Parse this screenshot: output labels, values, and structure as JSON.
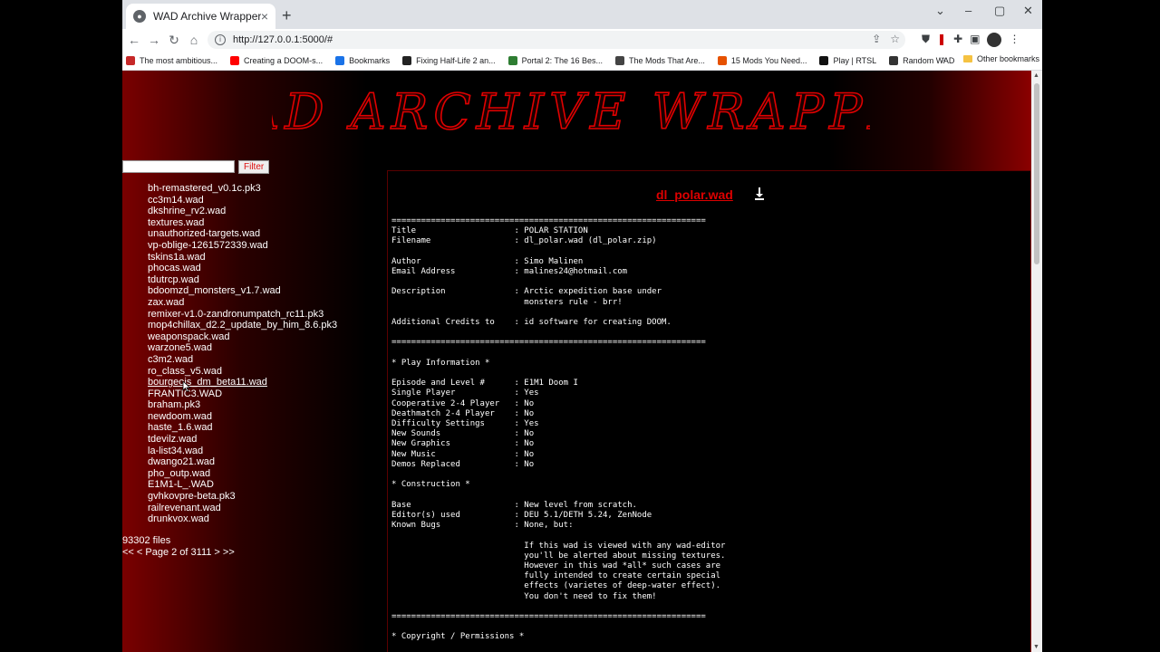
{
  "browser": {
    "tab_title": "WAD Archive Wrapper",
    "url": "http://127.0.0.1:5000/#",
    "bookmarks": [
      {
        "label": "The most ambitious...",
        "color": "#c62828"
      },
      {
        "label": "Creating a DOOM-s...",
        "color": "#ff0000"
      },
      {
        "label": "Bookmarks",
        "color": "#1a73e8"
      },
      {
        "label": "Fixing Half-Life 2 an...",
        "color": "#222222"
      },
      {
        "label": "Portal 2: The 16 Bes...",
        "color": "#2e7d32"
      },
      {
        "label": "The Mods That Are...",
        "color": "#444444"
      },
      {
        "label": "15 Mods You Need...",
        "color": "#e65100"
      },
      {
        "label": "Play | RTSL",
        "color": "#111111"
      },
      {
        "label": "Random WAD",
        "color": "#333333"
      }
    ],
    "other_bookmarks": "Other bookmarks"
  },
  "page": {
    "logo_text": "WAD ARCHIVE WRAPPER",
    "filter_button": "Filter",
    "filter_value": "",
    "files": [
      "bh-remastered_v0.1c.pk3",
      "cc3m14.wad",
      "dkshrine_rv2.wad",
      "textures.wad",
      "unauthorized-targets.wad",
      "vp-oblige-1261572339.wad",
      "tskins1a.wad",
      "phocas.wad",
      "tdutrcp.wad",
      "bdoomzd_monsters_v1.7.wad",
      "zax.wad",
      "remixer-v1.0-zandronumpatch_rc11.pk3",
      "mop4chillax_d2.2_update_by_him_8.6.pk3",
      "weaponspack.wad",
      "warzone5.wad",
      "c3m2.wad",
      "ro_class_v5.wad",
      "bourgeois_dm_beta11.wad",
      "FRANTIC3.WAD",
      "braham.pk3",
      "newdoom.wad",
      "haste_1.6.wad",
      "tdevilz.wad",
      "la-list34.wad",
      "dwango21.wad",
      "pho_outp.wad",
      "E1M1-L_.WAD",
      "gvhkovpre-beta.pk3",
      "railrevenant.wad",
      "drunkvox.wad"
    ],
    "file_count": "93302 files",
    "pager": "<< < Page 2 of 3111 > >>",
    "doc_title": "dl_polar.wad",
    "doc_text": "================================================================\nTitle                    : POLAR STATION\nFilename                 : dl_polar.wad (dl_polar.zip)\n\nAuthor                   : Simo Malinen\nEmail Address            : malines24@hotmail.com\n\nDescription              : Arctic expedition base under\n                           monsters rule - brr!\n\nAdditional Credits to    : id software for creating DOOM.\n\n================================================================\n\n* Play Information *\n\nEpisode and Level #      : E1M1 Doom I\nSingle Player            : Yes\nCooperative 2-4 Player   : No\nDeathmatch 2-4 Player    : No\nDifficulty Settings      : Yes\nNew Sounds               : No\nNew Graphics             : No\nNew Music                : No\nDemos Replaced           : No\n\n* Construction *\n\nBase                     : New level from scratch.\nEditor(s) used           : DEU 5.1/DETH 5.24, ZenNode\nKnown Bugs               : None, but:\n\n                           If this wad is viewed with any wad-editor\n                           you'll be alerted about missing textures.\n                           However in this wad *all* such cases are\n                           fully intended to create certain special\n                           effects (varietes of deep-water effect).\n                           You don't need to fix them!\n\n================================================================\n\n* Copyright / Permissions *"
  }
}
